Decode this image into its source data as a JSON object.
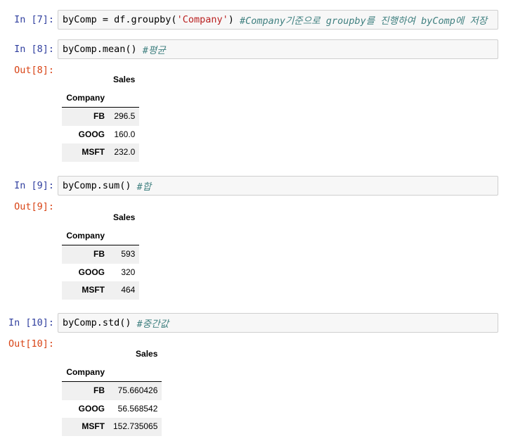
{
  "cells": [
    {
      "in_prompt": "In [7]:",
      "code": {
        "pre": "byComp = df.groupby(",
        "string": "'Company'",
        "post": ") ",
        "comment": "#Company기준으로 groupby를 진행하여 byComp에 저장"
      }
    },
    {
      "in_prompt": "In [8]:",
      "code": {
        "pre": "byComp.mean() ",
        "comment": "#평균"
      },
      "out_prompt": "Out[8]:",
      "table": {
        "column_header": "Sales",
        "index_name": "Company",
        "rows": [
          {
            "index": "FB",
            "value": "296.5"
          },
          {
            "index": "GOOG",
            "value": "160.0"
          },
          {
            "index": "MSFT",
            "value": "232.0"
          }
        ]
      }
    },
    {
      "in_prompt": "In [9]:",
      "code": {
        "pre": "byComp.sum() ",
        "comment": "#합"
      },
      "out_prompt": "Out[9]:",
      "table": {
        "column_header": "Sales",
        "index_name": "Company",
        "rows": [
          {
            "index": "FB",
            "value": "593"
          },
          {
            "index": "GOOG",
            "value": "320"
          },
          {
            "index": "MSFT",
            "value": "464"
          }
        ]
      }
    },
    {
      "in_prompt": "In [10]:",
      "code": {
        "pre": "byComp.std() ",
        "comment": "#중간값"
      },
      "out_prompt": "Out[10]:",
      "table": {
        "column_header": "Sales",
        "index_name": "Company",
        "rows": [
          {
            "index": "FB",
            "value": "75.660426"
          },
          {
            "index": "GOOG",
            "value": "56.568542"
          },
          {
            "index": "MSFT",
            "value": "152.735065"
          }
        ]
      }
    }
  ]
}
